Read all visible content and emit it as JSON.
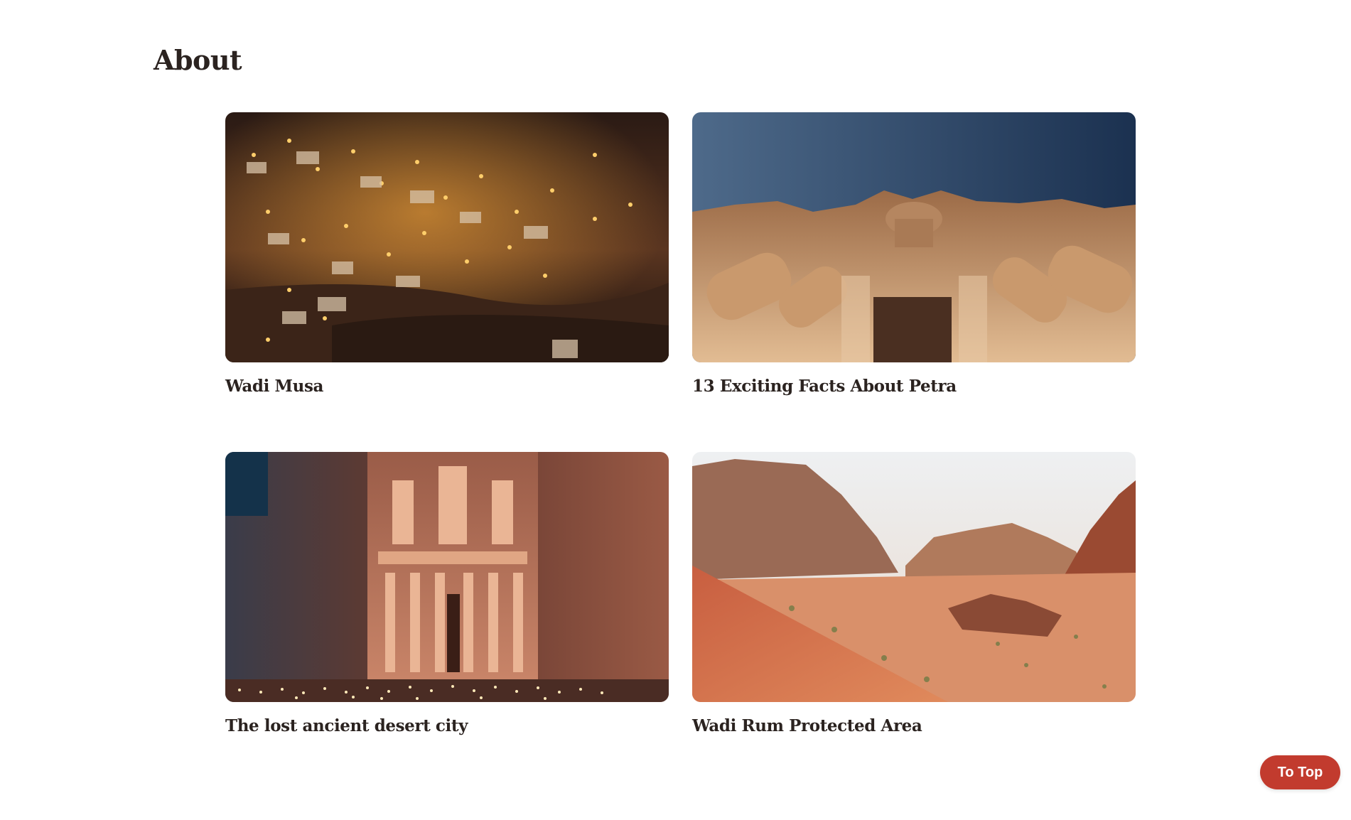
{
  "section": {
    "title": "About"
  },
  "cards": [
    {
      "title": "Wadi Musa",
      "image": "night-town-on-hillside-photo"
    },
    {
      "title": "13 Exciting Facts About Petra",
      "image": "monastery-facade-from-below-photo"
    },
    {
      "title": "The lost ancient desert city",
      "image": "treasury-by-candlelight-photo"
    },
    {
      "title": "Wadi Rum Protected Area",
      "image": "red-desert-canyon-photo"
    }
  ],
  "to_top": {
    "label": "To Top"
  },
  "colors": {
    "heading": "#2b2320",
    "accent": "#c23b2e",
    "background": "#ffffff"
  }
}
